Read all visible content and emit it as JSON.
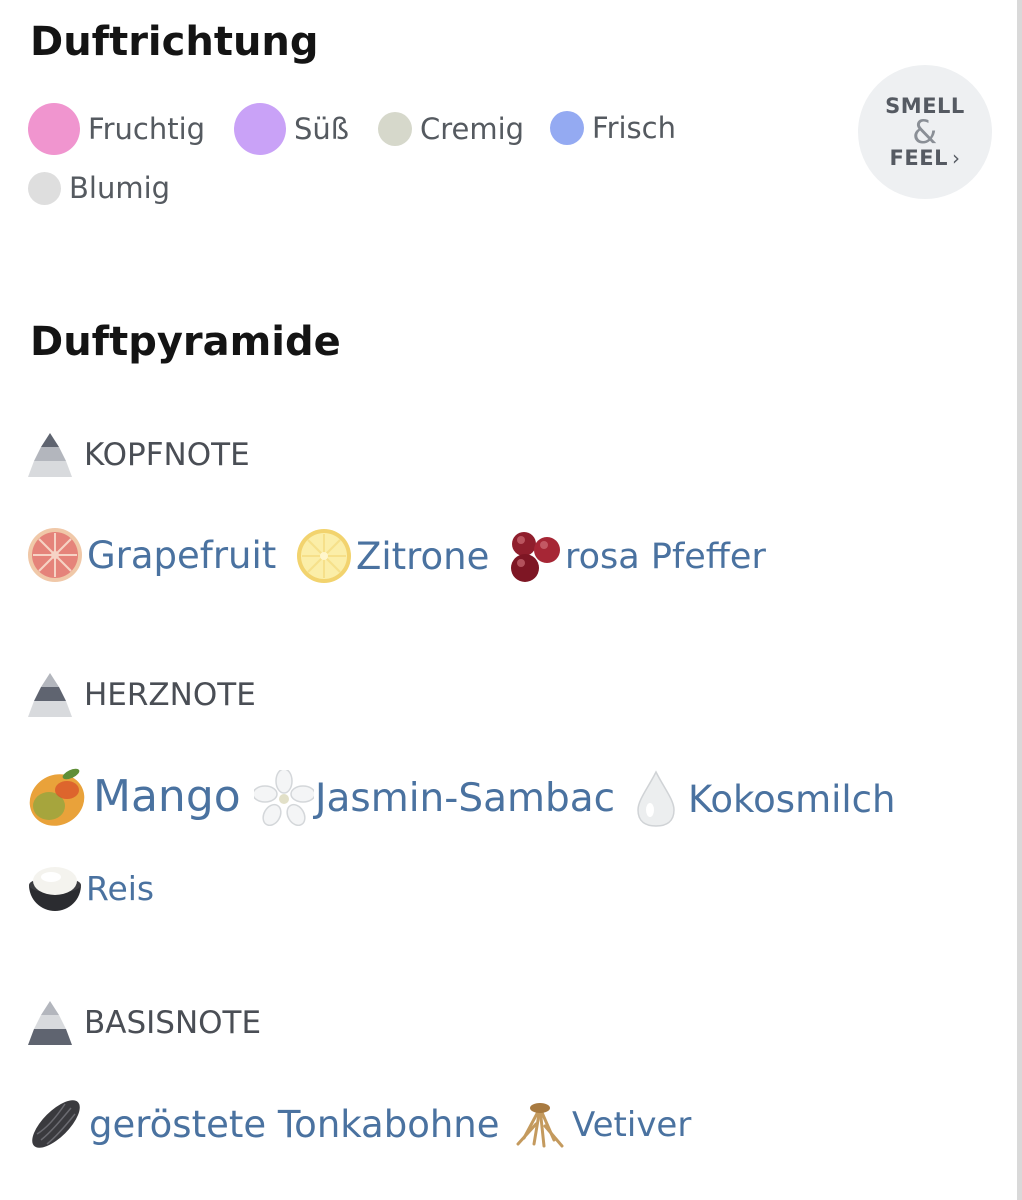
{
  "scent_direction": {
    "title": "Duftrichtung",
    "chips": [
      {
        "label": "Fruchtig",
        "color": "#f095cf"
      },
      {
        "label": "Süß",
        "color": "#c9a2f7"
      },
      {
        "label": "Cremig",
        "color": "#d6d8cb"
      },
      {
        "label": "Frisch",
        "color": "#94aaf2"
      },
      {
        "label": "Blumig",
        "color": "#dedede"
      }
    ],
    "smell_feel": {
      "line1": "SMELL",
      "amp": "&",
      "line2": "FEEL",
      "chevron": "›"
    }
  },
  "pyramid": {
    "title": "Duftpyramide",
    "top_note": {
      "label": "KOPFNOTE",
      "ingredients": [
        {
          "label": "Grapefruit",
          "icon": "grapefruit-icon"
        },
        {
          "label": "Zitrone",
          "icon": "lemon-icon"
        },
        {
          "label": "rosa Pfeffer",
          "icon": "pink-pepper-icon"
        }
      ]
    },
    "heart_note": {
      "label": "HERZNOTE",
      "ingredients": [
        {
          "label": "Mango",
          "icon": "mango-icon"
        },
        {
          "label": "Jasmin-Sambac",
          "icon": "jasmine-flower-icon"
        },
        {
          "label": "Kokosmilch",
          "icon": "milk-drop-icon"
        },
        {
          "label": "Reis",
          "icon": "rice-bowl-icon"
        }
      ]
    },
    "base_note": {
      "label": "BASISNOTE",
      "ingredients": [
        {
          "label": "geröstete Tonkabohne",
          "icon": "tonka-bean-icon"
        },
        {
          "label": "Vetiver",
          "icon": "vetiver-root-icon"
        }
      ]
    }
  }
}
